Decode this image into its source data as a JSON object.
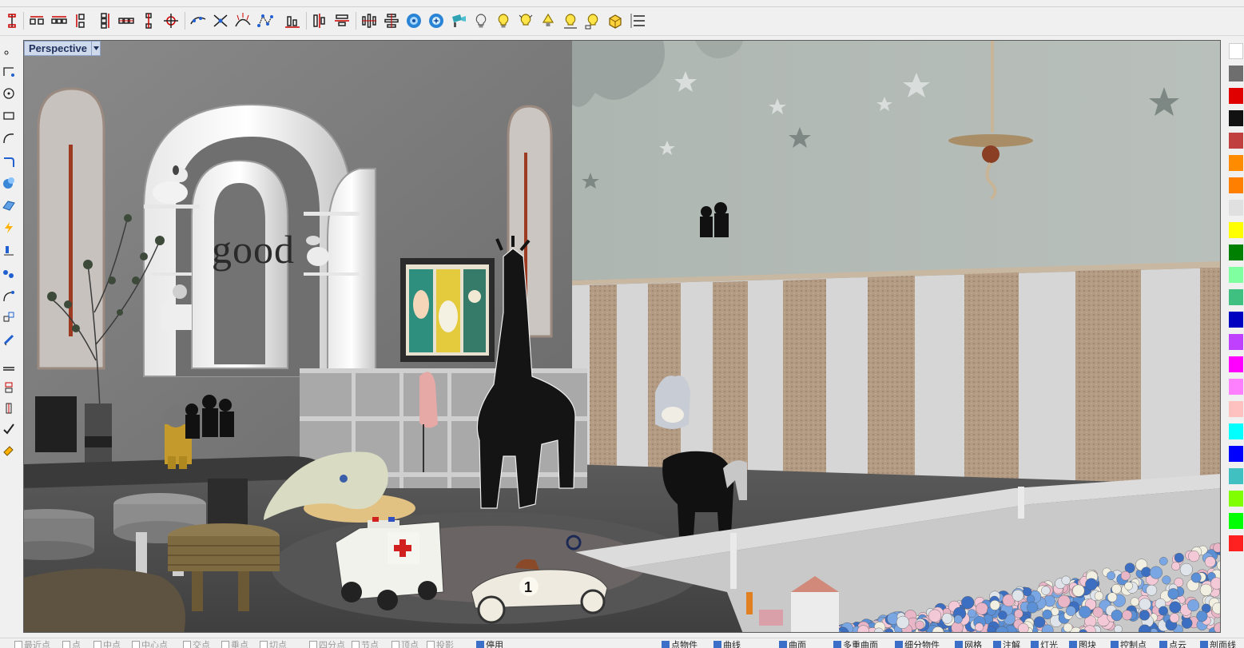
{
  "viewport": {
    "name": "Perspective",
    "wall_text": "good",
    "car_number": "1"
  },
  "toolbar_top": {
    "icons": [
      "vertical-distance-icon",
      "horizontal-dimension-icon",
      "horizontal-dimension-2-icon",
      "vertical-dimension-icon",
      "vertical-dimension-2-icon",
      "chain-dimension-icon",
      "vertical-chain-icon",
      "snap-center-icon",
      "curve-network-icon",
      "curve-intersect-icon",
      "curve-analysis-icon",
      "control-points-icon",
      "align-bottom-icon",
      "align-vertical-icon",
      "align-center-icon",
      "distribute-vertical-icon",
      "distribute-horizontal-icon",
      "render-sphere-icon",
      "render-settings-icon",
      "camera-icon",
      "light-bulb-off-icon",
      "light-bulb-on-icon",
      "light-bulb-multi-icon",
      "light-bulb-spot-icon",
      "light-bulb-linear-icon",
      "light-bulb-rect-icon",
      "box-light-icon",
      "layer-list-icon"
    ]
  },
  "toolbar_left": {
    "icons": [
      "point-icon",
      "polyline-icon",
      "circle-icon",
      "rectangle-icon",
      "curve-icon",
      "fillet-icon",
      "surface-icon",
      "sphere-icon",
      "plane-surface-icon",
      "boolean-icon",
      "transform-icon",
      "vertex-icon",
      "rotate-icon",
      "scale-icon",
      "align-icon",
      "cut-icon",
      "measure-icon",
      "check-icon",
      "paint-icon"
    ]
  },
  "color_strip": {
    "colors": [
      "#ffffff",
      "#6e6e6e",
      "#e00000",
      "#111111",
      "#c04040",
      "#ff8c00",
      "#ff7f00",
      "#e0e0e0",
      "#ffff00",
      "#008000",
      "#7fffa0",
      "#40c080",
      "#0000c0",
      "#c040ff",
      "#ff00ff",
      "#ff80ff",
      "#ffc0c0",
      "#00ffff",
      "#0000ff",
      "#40c0c0",
      "#80ff00",
      "#00ff00",
      "#ff2020"
    ]
  },
  "statusbar": {
    "osnaps": [
      {
        "label": "最近点",
        "on": false
      },
      {
        "label": "点",
        "on": false
      },
      {
        "label": "中点",
        "on": false
      },
      {
        "label": "中心点",
        "on": false
      },
      {
        "label": "交点",
        "on": false
      },
      {
        "label": "垂点",
        "on": false
      },
      {
        "label": "切点",
        "on": false
      },
      {
        "label": "四分点",
        "on": false
      },
      {
        "label": "节点",
        "on": false
      },
      {
        "label": "顶点",
        "on": false
      },
      {
        "label": "投影",
        "on": false
      },
      {
        "label": "停用",
        "on": true
      }
    ],
    "filters": [
      {
        "label": "点物件",
        "on": true
      },
      {
        "label": "曲线",
        "on": true
      },
      {
        "label": "曲面",
        "on": true
      },
      {
        "label": "多重曲面",
        "on": true
      },
      {
        "label": "细分物件",
        "on": true
      },
      {
        "label": "网格",
        "on": true
      },
      {
        "label": "注解",
        "on": true
      },
      {
        "label": "灯光",
        "on": true
      },
      {
        "label": "图块",
        "on": true
      },
      {
        "label": "控制点",
        "on": true
      },
      {
        "label": "点云",
        "on": true
      },
      {
        "label": "剖面线",
        "on": true
      }
    ]
  }
}
